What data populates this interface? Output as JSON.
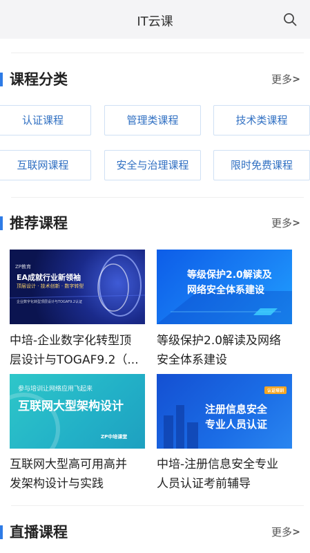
{
  "header": {
    "title": "IT云课",
    "search_icon": "search-icon"
  },
  "categories": {
    "title": "课程分类",
    "more_label": "更多",
    "more_arrow": ">",
    "items": [
      "认证课程",
      "管理类课程",
      "技术类课程",
      "互联网课程",
      "安全与治理课程",
      "限时免费课程"
    ]
  },
  "recommended": {
    "title": "推荐课程",
    "more_label": "更多",
    "more_arrow": ">",
    "courses": [
      {
        "title_line1": "中培-企业数字化转型顶",
        "title_line2": "层设计与TOGAF9.2（...",
        "banner_top": "ZP教育",
        "banner_main": "EA成就行业新领袖",
        "banner_sub": "顶层设计 · 技术创新 · 数字转型",
        "banner_foot": "企业数字化转型顶层设计与TOGAF9.2认证",
        "color": "#1a2a8a"
      },
      {
        "title_line1": "等级保护2.0解读及网络",
        "title_line2": "安全体系建设",
        "banner_main": "等级保护2.0解读及",
        "banner_sub": "网络安全体系建设",
        "color": "#0d5de8"
      },
      {
        "title_line1": "互联网大型高可用高并",
        "title_line2": "发架构设计与实践",
        "banner_top": "参与培训让网络应用飞起来",
        "banner_main": "互联网大型架构设计",
        "banner_foot": "ZP中培课堂",
        "color": "#2ec7c9"
      },
      {
        "title_line1": "中培-注册信息安全专业",
        "title_line2": "人员认证考前辅导",
        "banner_tag": "认证培训",
        "banner_main": "注册信息安全",
        "banner_sub": "专业人员认证",
        "color": "#1450d2"
      }
    ]
  },
  "live": {
    "title": "直播课程",
    "more_label": "更多",
    "more_arrow": ">"
  },
  "colors": {
    "accent": "#2e7be6",
    "button_text": "#2f6fc2",
    "button_border": "#cfe0f4"
  }
}
